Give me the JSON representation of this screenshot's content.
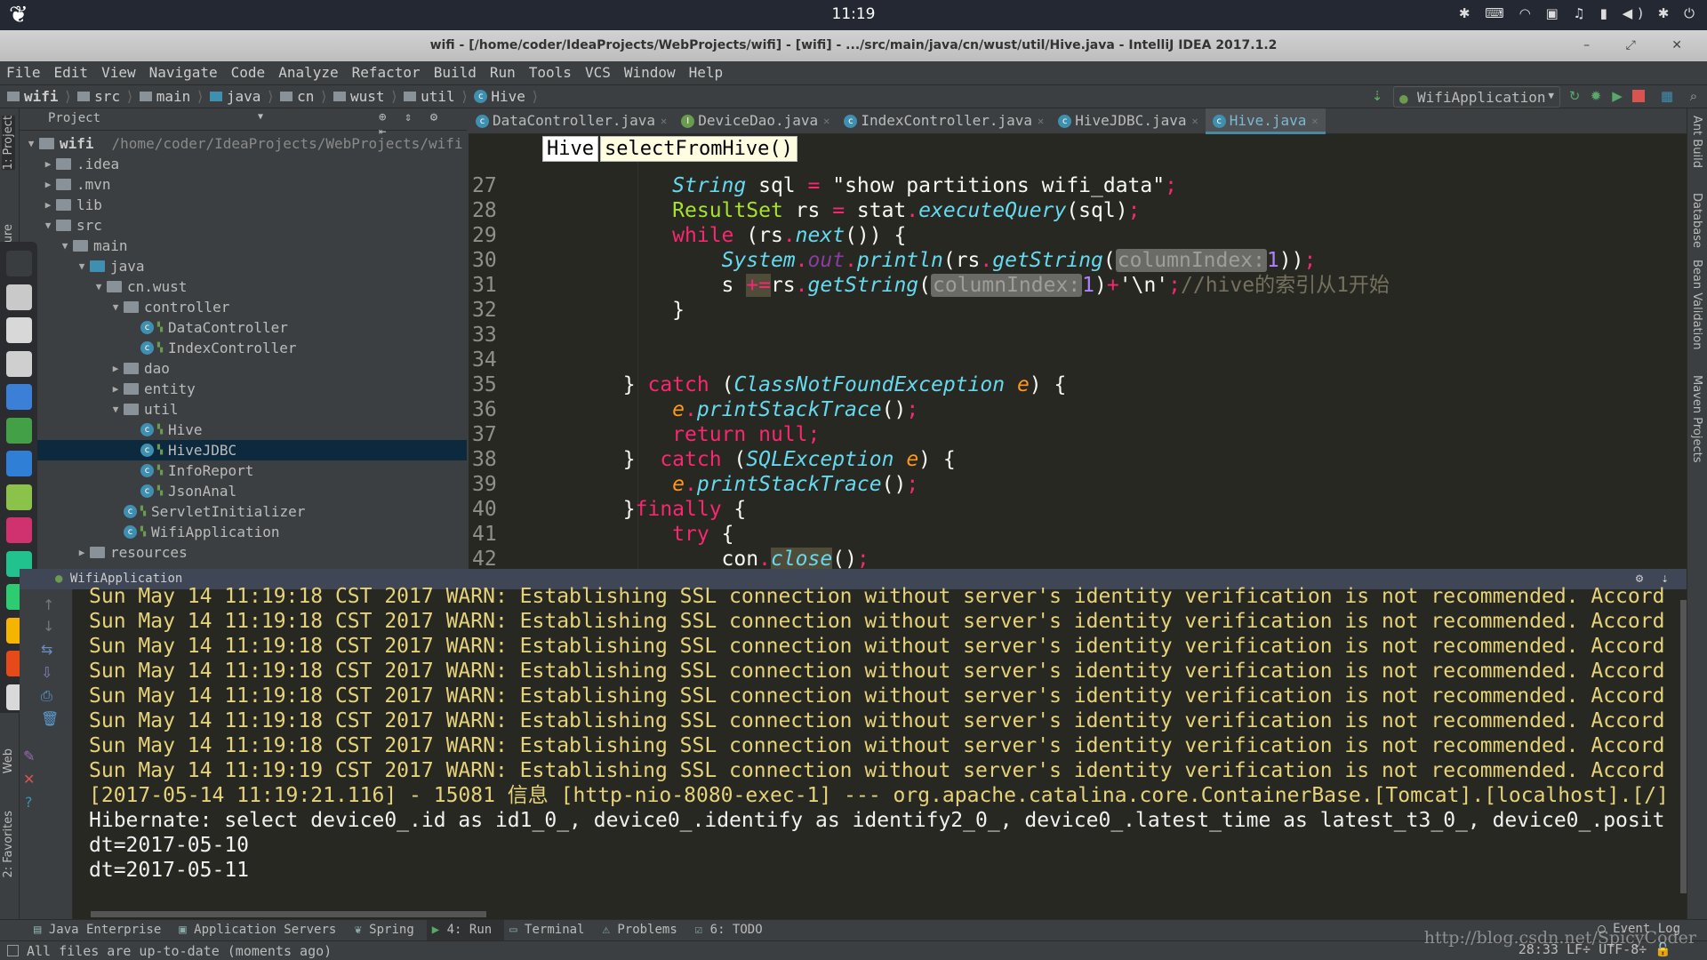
{
  "system": {
    "clock": "11:19"
  },
  "window": {
    "title": "wifi - [/home/coder/IdeaProjects/WebProjects/wifi] - [wifi] - .../src/main/java/cn/wust/util/Hive.java - IntelliJ IDEA 2017.1.2"
  },
  "menu": [
    "File",
    "Edit",
    "View",
    "Navigate",
    "Code",
    "Analyze",
    "Refactor",
    "Build",
    "Run",
    "Tools",
    "VCS",
    "Window",
    "Help"
  ],
  "navbar": {
    "crumbs": [
      "wifi",
      "src",
      "main",
      "java",
      "cn",
      "wust",
      "util",
      "Hive"
    ]
  },
  "toolbar": {
    "run_config": "WifiApplication"
  },
  "left_strip": {
    "project_tab": "1: Project",
    "structure_tab": "7: Structure",
    "web_tab": "Web",
    "favorites_tab": "2: Favorites"
  },
  "project": {
    "header": "Project",
    "root_label": "wifi",
    "root_path": "/home/coder/IdeaProjects/WebProjects/wifi",
    "items": [
      {
        "label": ".idea",
        "depth": 1,
        "icon": "folder",
        "state": "collapsed"
      },
      {
        "label": ".mvn",
        "depth": 1,
        "icon": "folder",
        "state": "collapsed"
      },
      {
        "label": "lib",
        "depth": 1,
        "icon": "folder",
        "state": "collapsed"
      },
      {
        "label": "src",
        "depth": 1,
        "icon": "folder",
        "state": "expanded"
      },
      {
        "label": "main",
        "depth": 2,
        "icon": "folder",
        "state": "expanded"
      },
      {
        "label": "java",
        "depth": 3,
        "icon": "source-folder",
        "state": "expanded"
      },
      {
        "label": "cn.wust",
        "depth": 4,
        "icon": "package",
        "state": "expanded"
      },
      {
        "label": "controller",
        "depth": 5,
        "icon": "package",
        "state": "expanded"
      },
      {
        "label": "DataController",
        "depth": 6,
        "icon": "class",
        "state": "leaf"
      },
      {
        "label": "IndexController",
        "depth": 6,
        "icon": "class",
        "state": "leaf"
      },
      {
        "label": "dao",
        "depth": 5,
        "icon": "package",
        "state": "collapsed"
      },
      {
        "label": "entity",
        "depth": 5,
        "icon": "package",
        "state": "collapsed"
      },
      {
        "label": "util",
        "depth": 5,
        "icon": "package",
        "state": "expanded"
      },
      {
        "label": "Hive",
        "depth": 6,
        "icon": "class",
        "state": "leaf"
      },
      {
        "label": "HiveJDBC",
        "depth": 6,
        "icon": "class",
        "state": "leaf",
        "selected": true
      },
      {
        "label": "InfoReport",
        "depth": 6,
        "icon": "class",
        "state": "leaf"
      },
      {
        "label": "JsonAnal",
        "depth": 6,
        "icon": "class",
        "state": "leaf"
      },
      {
        "label": "ServletInitializer",
        "depth": 5,
        "icon": "class",
        "state": "leaf"
      },
      {
        "label": "WifiApplication",
        "depth": 5,
        "icon": "spring-boot-class",
        "state": "leaf"
      },
      {
        "label": "resources",
        "depth": 3,
        "icon": "resources-folder",
        "state": "collapsed"
      }
    ]
  },
  "editor": {
    "tabs": [
      {
        "label": "DataController.java",
        "icon": "class"
      },
      {
        "label": "DeviceDao.java",
        "icon": "interface"
      },
      {
        "label": "IndexController.java",
        "icon": "class"
      },
      {
        "label": "HiveJDBC.java",
        "icon": "class"
      },
      {
        "label": "Hive.java",
        "icon": "class",
        "active": true
      }
    ],
    "breadcrumb": {
      "class": "Hive",
      "method": "selectFromHive()"
    },
    "lines": [
      {
        "n": "27",
        "tokens": [
          [
            "            ",
            "pl"
          ],
          [
            "String",
            "ty"
          ],
          [
            " sql ",
            "pl"
          ],
          [
            "=",
            "op"
          ],
          [
            " \"show partitions wifi_data\"",
            "st"
          ],
          [
            ";",
            "op"
          ]
        ]
      },
      {
        "n": "28",
        "tokens": [
          [
            "            ",
            "pl"
          ],
          [
            "ResultSet",
            "cls"
          ],
          [
            " rs ",
            "pl"
          ],
          [
            "=",
            "op"
          ],
          [
            " stat",
            "pl"
          ],
          [
            ".",
            "op"
          ],
          [
            "executeQuery",
            "fn"
          ],
          [
            "(sql)",
            "pl"
          ],
          [
            ";",
            "op"
          ]
        ]
      },
      {
        "n": "29",
        "tokens": [
          [
            "            ",
            "pl"
          ],
          [
            "while",
            "kw"
          ],
          [
            " (rs",
            "pl"
          ],
          [
            ".",
            "op"
          ],
          [
            "next",
            "fn"
          ],
          [
            "()) {",
            "pl"
          ]
        ]
      },
      {
        "n": "30",
        "tokens": [
          [
            "                ",
            "pl"
          ],
          [
            "System",
            "ty"
          ],
          [
            ".",
            "op"
          ],
          [
            "out",
            "fld"
          ],
          [
            ".",
            "op"
          ],
          [
            "println",
            "fn"
          ],
          [
            "(rs",
            "pl"
          ],
          [
            ".",
            "op"
          ],
          [
            "getString",
            "fn"
          ],
          [
            "(",
            "pl"
          ],
          [
            "columnIndex:",
            "hint"
          ],
          [
            "1",
            "num"
          ],
          [
            "))",
            "pl"
          ],
          [
            ";",
            "op"
          ]
        ]
      },
      {
        "n": "31",
        "tokens": [
          [
            "                s ",
            "pl"
          ],
          [
            "+=",
            "op hl"
          ],
          [
            "rs",
            "pl"
          ],
          [
            ".",
            "op"
          ],
          [
            "getString",
            "fn"
          ],
          [
            "(",
            "pl"
          ],
          [
            "columnIndex:",
            "hint"
          ],
          [
            "1",
            "num"
          ],
          [
            ")",
            "pl"
          ],
          [
            "+",
            "op"
          ],
          [
            "'\\n'",
            "st"
          ],
          [
            ";",
            "op"
          ],
          [
            "//hive的索引从1开始",
            "cm"
          ]
        ]
      },
      {
        "n": "32",
        "tokens": [
          [
            "            }",
            "pl"
          ]
        ]
      },
      {
        "n": "33",
        "tokens": []
      },
      {
        "n": "34",
        "tokens": []
      },
      {
        "n": "35",
        "tokens": [
          [
            "        } ",
            "pl"
          ],
          [
            "catch",
            "kw"
          ],
          [
            " (",
            "pl"
          ],
          [
            "ClassNotFoundException",
            "ty"
          ],
          [
            " ",
            "pl"
          ],
          [
            "e",
            "pr"
          ],
          [
            ") {",
            "pl"
          ]
        ]
      },
      {
        "n": "36",
        "tokens": [
          [
            "            ",
            "pl"
          ],
          [
            "e",
            "pr"
          ],
          [
            ".",
            "op"
          ],
          [
            "printStackTrace",
            "fn"
          ],
          [
            "()",
            "pl"
          ],
          [
            ";",
            "op"
          ]
        ]
      },
      {
        "n": "37",
        "tokens": [
          [
            "            ",
            "pl"
          ],
          [
            "return null;",
            "kw"
          ]
        ]
      },
      {
        "n": "38",
        "tokens": [
          [
            "        }  ",
            "pl"
          ],
          [
            "catch",
            "kw"
          ],
          [
            " (",
            "pl"
          ],
          [
            "SQLException",
            "ty"
          ],
          [
            " ",
            "pl"
          ],
          [
            "e",
            "pr"
          ],
          [
            ") {",
            "pl"
          ]
        ]
      },
      {
        "n": "39",
        "tokens": [
          [
            "            ",
            "pl"
          ],
          [
            "e",
            "pr"
          ],
          [
            ".",
            "op"
          ],
          [
            "printStackTrace",
            "fn"
          ],
          [
            "()",
            "pl"
          ],
          [
            ";",
            "op"
          ]
        ]
      },
      {
        "n": "40",
        "tokens": [
          [
            "        }",
            "pl"
          ],
          [
            "finally",
            "kw"
          ],
          [
            " {",
            "pl"
          ]
        ]
      },
      {
        "n": "41",
        "tokens": [
          [
            "            ",
            "pl"
          ],
          [
            "try",
            "kw"
          ],
          [
            " {",
            "pl"
          ]
        ]
      },
      {
        "n": "42",
        "tokens": [
          [
            "                con",
            "pl"
          ],
          [
            ".",
            "op"
          ],
          [
            "close",
            "fn hl"
          ],
          [
            "()",
            "pl"
          ],
          [
            ";",
            "op"
          ]
        ]
      }
    ]
  },
  "right_strip": [
    "Ant Build",
    "Database",
    "Bean Validation",
    "Maven Projects"
  ],
  "run": {
    "header_prefix": "Run",
    "config": "WifiApplication",
    "console": [
      {
        "text": "Sun May 14 11:19:18 CST 2017 WARN: Establishing SSL connection without server's identity verification is not recommended. Accord",
        "kind": "warn"
      },
      {
        "text": "Sun May 14 11:19:18 CST 2017 WARN: Establishing SSL connection without server's identity verification is not recommended. Accord",
        "kind": "warn"
      },
      {
        "text": "Sun May 14 11:19:18 CST 2017 WARN: Establishing SSL connection without server's identity verification is not recommended. Accord",
        "kind": "warn"
      },
      {
        "text": "Sun May 14 11:19:18 CST 2017 WARN: Establishing SSL connection without server's identity verification is not recommended. Accord",
        "kind": "warn"
      },
      {
        "text": "Sun May 14 11:19:18 CST 2017 WARN: Establishing SSL connection without server's identity verification is not recommended. Accord",
        "kind": "warn"
      },
      {
        "text": "Sun May 14 11:19:18 CST 2017 WARN: Establishing SSL connection without server's identity verification is not recommended. Accord",
        "kind": "warn"
      },
      {
        "text": "Sun May 14 11:19:18 CST 2017 WARN: Establishing SSL connection without server's identity verification is not recommended. Accord",
        "kind": "warn"
      },
      {
        "text": "Sun May 14 11:19:19 CST 2017 WARN: Establishing SSL connection without server's identity verification is not recommended. Accord",
        "kind": "warn"
      },
      {
        "text": "[2017-05-14 11:19:21.116] - 15081 信息 [http-nio-8080-exec-1] --- org.apache.catalina.core.ContainerBase.[Tomcat].[localhost].[/]",
        "kind": "info"
      },
      {
        "text": "Hibernate: select device0_.id as id1_0_, device0_.identify as identify2_0_, device0_.latest_time as latest_t3_0_, device0_.posit",
        "kind": "plain"
      },
      {
        "text": "dt=2017-05-10",
        "kind": "plain"
      },
      {
        "text": "dt=2017-05-11",
        "kind": "plain"
      }
    ]
  },
  "bottom_tabs": [
    {
      "label": "Java Enterprise"
    },
    {
      "label": "Application Servers"
    },
    {
      "label": "Spring"
    },
    {
      "label": "4: Run",
      "active": true
    },
    {
      "label": "Terminal"
    },
    {
      "label": "Problems"
    },
    {
      "label": "6: TODO"
    }
  ],
  "event_log": "Event Log",
  "status": {
    "message": "All files are up-to-date (moments ago)",
    "position": "28:33",
    "line_sep": "LF÷",
    "encoding": "UTF-8÷"
  },
  "watermark": "http://blog.csdn.net/SpicyCoder"
}
